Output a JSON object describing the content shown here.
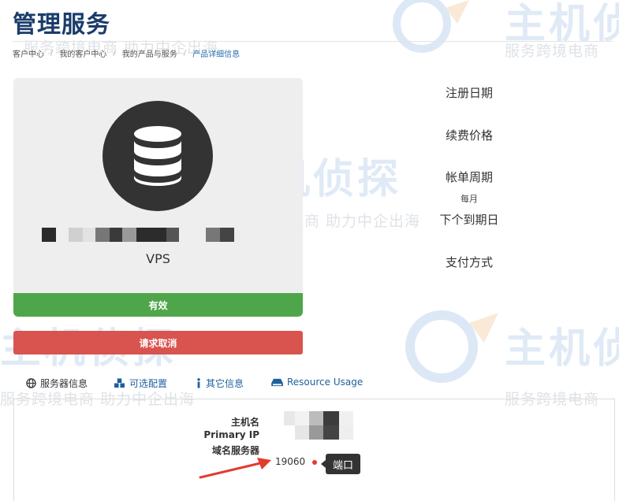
{
  "header": {
    "title": "管理服务"
  },
  "breadcrumb": [
    {
      "label": "客户中心"
    },
    {
      "label": "我的客户中心"
    },
    {
      "label": "我的产品与服务"
    },
    {
      "label": "产品详细信息"
    }
  ],
  "product": {
    "icon": "database-icon",
    "name": "VPS",
    "status": "有效",
    "cancel_label": "请求取消"
  },
  "info": {
    "registration_date_label": "注册日期",
    "renewal_price_label": "续费价格",
    "billing_cycle_label": "帐单周期",
    "billing_cycle_value": "每月",
    "next_due_date_label": "下个到期日",
    "payment_method_label": "支付方式"
  },
  "tabs": [
    {
      "label": "服务器信息",
      "icon": "globe-icon"
    },
    {
      "label": "可选配置",
      "icon": "cubes-icon"
    },
    {
      "label": "其它信息",
      "icon": "info-icon"
    },
    {
      "label": "Resource Usage",
      "icon": "hdd-icon"
    }
  ],
  "server_info": {
    "hostname_label": "主机名",
    "primary_ip_label": "Primary IP",
    "nameservers_label": "域名服务器",
    "port_value": "19060",
    "port_tooltip": "端口"
  },
  "watermark": {
    "brand": "主机侦探",
    "slogan": "服务跨境电商 助力中企出海",
    "slogan_short": "服务跨境电商"
  },
  "colors": {
    "title": "#1a3c6b",
    "status_active": "#4fa64a",
    "cancel": "#d9534f",
    "link": "#1f5f9c",
    "annotation": "#e23b2e"
  }
}
